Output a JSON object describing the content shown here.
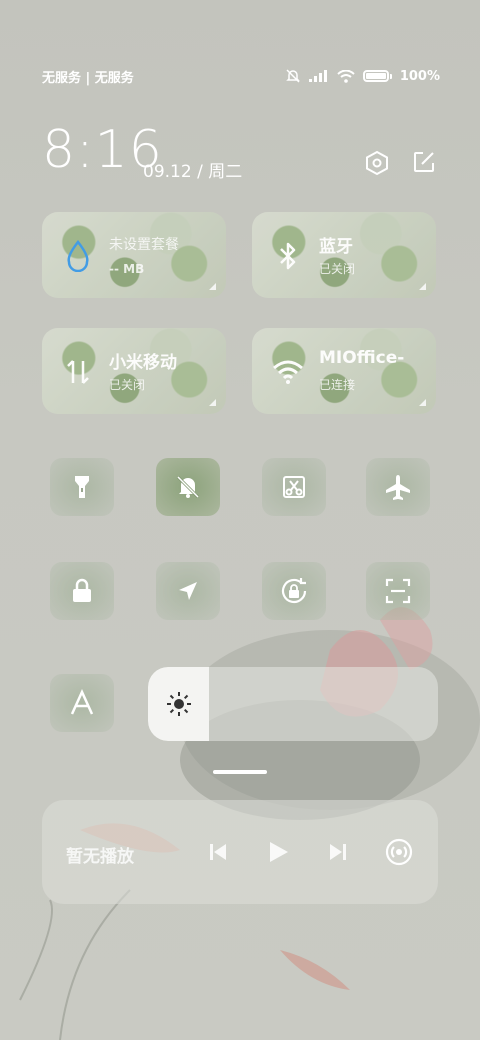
{
  "status": {
    "carrier": "无服务 | 无服务",
    "battery": "100%"
  },
  "clock": {
    "time": "8:16",
    "date": "09.12 / 周二"
  },
  "tiles_large": [
    {
      "title": "未设置套餐",
      "sub": "-- MB",
      "icon": "water-drop-icon"
    },
    {
      "title": "蓝牙",
      "sub": "已关闭",
      "icon": "bluetooth-icon"
    },
    {
      "title": "小米移动",
      "sub": "已关闭",
      "icon": "mobile-data-icon"
    },
    {
      "title": "MIOffice-",
      "sub": "已连接",
      "icon": "wifi-icon"
    }
  ],
  "tiles_small": [
    {
      "name": "flashlight",
      "icon": "flashlight-icon"
    },
    {
      "name": "mute",
      "icon": "bell-off-icon"
    },
    {
      "name": "screenshot",
      "icon": "scissors-icon"
    },
    {
      "name": "airplane",
      "icon": "airplane-icon"
    },
    {
      "name": "lock",
      "icon": "lock-icon"
    },
    {
      "name": "location",
      "icon": "location-icon"
    },
    {
      "name": "rotation-lock",
      "icon": "rotation-lock-icon"
    },
    {
      "name": "scanner",
      "icon": "scan-icon"
    },
    {
      "name": "reading-mode",
      "icon": "font-icon"
    }
  ],
  "brightness": {
    "level": 0.21
  },
  "media": {
    "label": "暂无播放"
  },
  "colors": {
    "accent_blue": "#3b9ae8",
    "tile_green": "#8ea67a"
  }
}
